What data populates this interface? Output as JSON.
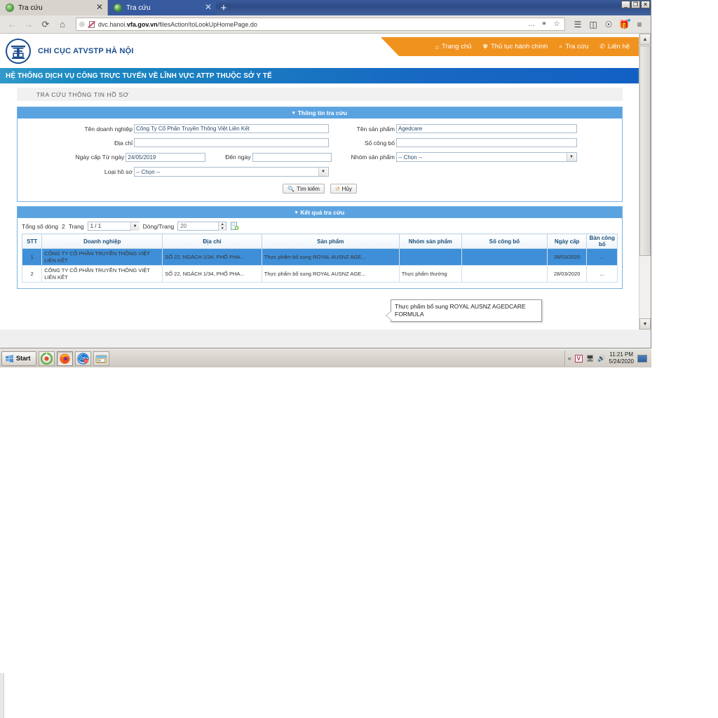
{
  "browser": {
    "tabs": [
      {
        "title": "Tra cứu",
        "active": false,
        "favicon": "green-circle-icon"
      },
      {
        "title": "Tra cứu",
        "active": true,
        "favicon": "green-circle-icon"
      }
    ],
    "new_tab_label": "+",
    "window_controls": {
      "minimize": "_",
      "maximize": "❐",
      "close": "✕"
    },
    "nav": {
      "back": "←",
      "forward": "→",
      "reload": "⟳",
      "home": "⌂"
    },
    "url": {
      "prefix": "dvc.hanoi.",
      "domain": "vfa.gov.vn",
      "path": "/filesAction!toLookUpHomePage.do",
      "shield_icon": "shield-icon",
      "lock_crossed_icon": "lock-crossed-icon",
      "more_icon": "…",
      "pocket_icon": "pocket-icon",
      "bookmark_icon": "☆"
    },
    "toolbar_icons": {
      "library": "library-icon",
      "sidebar": "sidebar-icon",
      "account": "account-icon",
      "gift": "gift-icon",
      "menu": "hamburger-menu-icon"
    }
  },
  "site": {
    "org_name": "CHI CỤC ATVSTP HÀ NỘI",
    "logo": "hanoi-gate-emblem-icon",
    "nav_items": [
      {
        "label": "Trang chủ",
        "icon": "home-icon",
        "glyph": "⌂"
      },
      {
        "label": "Thủ tục hành chính",
        "icon": "gear-icon",
        "glyph": "✾"
      },
      {
        "label": "Tra cứu",
        "icon": "search-icon",
        "glyph": "⌕"
      },
      {
        "label": "Liên hệ",
        "icon": "phone-icon",
        "glyph": "✆"
      }
    ],
    "banner": "HỆ THỐNG DỊCH VỤ CÔNG TRỰC TUYẾN VỀ LĨNH VỰC ATTP THUỘC SỞ Y TẾ",
    "breadcrumb": "TRA CỨU THÔNG TIN HỒ SƠ",
    "colors": {
      "orange_nav": "#f0921e",
      "banner_blue": "#1769c2",
      "panel_header_blue": "#5ba3e0",
      "row_selected_blue": "#3f8fd8",
      "logo_blue": "#1a4d8f"
    }
  },
  "search_panel": {
    "header": "Thông tin tra cứu",
    "caret": "▾",
    "fields": {
      "ten_doanh_nghiep": {
        "label": "Tên doanh nghiệp",
        "value": "Công Ty Cổ Phần Truyền Thông Việt Liên Kết"
      },
      "ten_san_pham": {
        "label": "Tên sản phẩm",
        "value": "Agedcare"
      },
      "dia_chi": {
        "label": "Địa chỉ",
        "value": ""
      },
      "so_cong_bo": {
        "label": "Số công bố",
        "value": ""
      },
      "ngay_cap_tu_ngay": {
        "label": "Ngày cấp Từ ngày",
        "value": "24/05/2019"
      },
      "den_ngay": {
        "label": "Đến ngày",
        "value": ""
      },
      "nhom_san_pham": {
        "label": "Nhóm sản phẩm",
        "value": "-- Chọn --"
      },
      "loai_ho_so": {
        "label": "Loại hồ sơ",
        "value": "-- Chọn --"
      }
    },
    "buttons": {
      "search": {
        "label": "Tìm kiếm",
        "icon": "magnifier-icon",
        "glyph": "⌕"
      },
      "cancel": {
        "label": "Hủy",
        "icon": "undo-icon",
        "glyph": "↺"
      }
    }
  },
  "result_panel": {
    "header": "Kết quả tra cứu",
    "caret": "▾",
    "toolbar": {
      "total_rows_label": "Tổng số dòng",
      "total_rows_value": "2",
      "page_label": "Trang",
      "page_value": "1 / 1",
      "rows_per_page_label": "Dòng/Trang",
      "rows_per_page_value": "20",
      "export_icon": "export-document-icon",
      "dropdown_caret": "▾",
      "spin_up": "▴",
      "spin_down": "▾"
    },
    "columns": [
      "STT",
      "Doanh nghiệp",
      "Địa chỉ",
      "Sản phẩm",
      "Nhóm sản phẩm",
      "Số công bố",
      "Ngày cấp",
      "Bản công bố"
    ],
    "rows": [
      {
        "stt": "1",
        "doanh_nghiep": "CÔNG TY CỔ PHẦN TRUYỀN THÔNG VIỆT LIÊN KẾT",
        "dia_chi": "SỐ 22, NGÁCH 1/34, PHỐ PHA...",
        "san_pham": "Thực phẩm bổ sung ROYAL AUSNZ AGE...",
        "nhom_san_pham": "",
        "so_cong_bo": "",
        "ngay_cap": "28/03/2020",
        "ban_cong_bo": "...",
        "selected": true
      },
      {
        "stt": "2",
        "doanh_nghiep": "CÔNG TY CỔ PHẦN TRUYỀN THÔNG VIỆT LIÊN KẾT",
        "dia_chi": "SỐ 22, NGÁCH 1/34, PHỐ PHA...",
        "san_pham": "Thực phẩm bổ sung ROYAL AUSNZ AGE...",
        "nhom_san_pham": "Thực phẩm thường",
        "so_cong_bo": "",
        "ngay_cap": "28/03/2020",
        "ban_cong_bo": "...",
        "selected": false
      }
    ],
    "tooltip": "Thực phẩm bổ sung ROYAL AUSNZ AGEDCARE FORMULA"
  },
  "taskbar": {
    "start_label": "Start",
    "items": [
      {
        "name": "app-icon-green",
        "glyph": "◉"
      },
      {
        "name": "firefox-icon",
        "glyph": "🦊"
      },
      {
        "name": "zalo-icon",
        "glyph": "Zalo"
      },
      {
        "name": "explorer-folder-icon",
        "glyph": "🗂"
      }
    ],
    "tray": {
      "overflow": "«",
      "v_icon": "V",
      "network_icon": "network-icon",
      "volume_icon": "volume-icon",
      "time": "11:21 PM",
      "date": "5/24/2020"
    }
  }
}
